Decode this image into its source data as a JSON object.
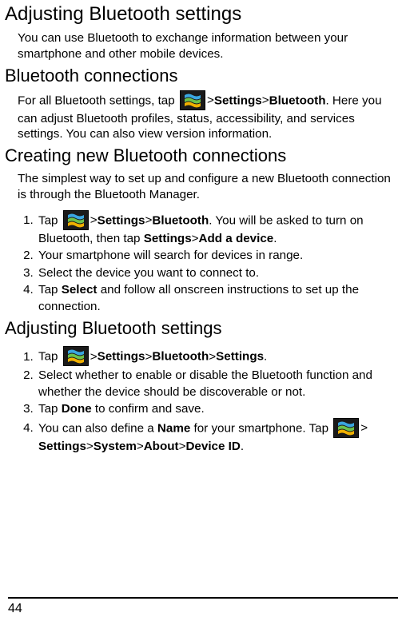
{
  "headings": {
    "h1": "Adjusting Bluetooth settings",
    "h2a": "Bluetooth connections",
    "h2b": "Creating new Bluetooth connections",
    "h2c": "Adjusting Bluetooth settings"
  },
  "intro": {
    "p1": "You can use Bluetooth to exchange information between your smartphone and other mobile devices."
  },
  "connections": {
    "lead": "For all Bluetooth settings, tap ",
    "sep1": " > ",
    "settings": "Settings",
    "sep2": " > ",
    "bluetooth": "Bluetooth",
    "tail": ". Here you can adjust Bluetooth profiles, status, accessibility, and services settings. You can also view version information."
  },
  "creating": {
    "p1": "The simplest way to set up and configure a new Bluetooth connection is through the Bluetooth Manager.",
    "li1a": "Tap ",
    "li1_sep1": " > ",
    "li1_settings": "Settings",
    "li1_sep2": " > ",
    "li1_bluetooth": "Bluetooth",
    "li1_mid": ". You will be asked to turn on Bluetooth, then tap ",
    "li1_settings2": "Settings",
    "li1_sep3": " > ",
    "li1_add": "Add a device",
    "li1_end": ".",
    "li2": "Your smartphone will search for devices in range.",
    "li3": "Select the device you want to connect to.",
    "li4a": "Tap ",
    "li4_select": "Select",
    "li4b": " and follow all onscreen instructions to set up the connection."
  },
  "adjusting": {
    "li1a": "Tap ",
    "li1_sep1": " > ",
    "li1_settings": "Settings",
    "li1_sep2": " > ",
    "li1_bluetooth": "Bluetooth",
    "li1_sep3": " > ",
    "li1_settings2": "Settings",
    "li1_end": ".",
    "li2": "Select whether to enable or disable the Bluetooth function and whether the device should be discoverable or not.",
    "li3a": "Tap ",
    "li3_done": "Done",
    "li3b": " to confirm and save.",
    "li4a": "You can also define a ",
    "li4_name": "Name",
    "li4b": " for your smartphone. Tap ",
    "li4_sep1": " > ",
    "li4_settings": "Settings",
    "li4_sep2": " > ",
    "li4_system": "System",
    "li4_sep3": " > ",
    "li4_about": "About",
    "li4_sep4": " > ",
    "li4_deviceid": "Device ID",
    "li4_end": "."
  },
  "page_number": "44",
  "icon_name": "windows-start-icon"
}
